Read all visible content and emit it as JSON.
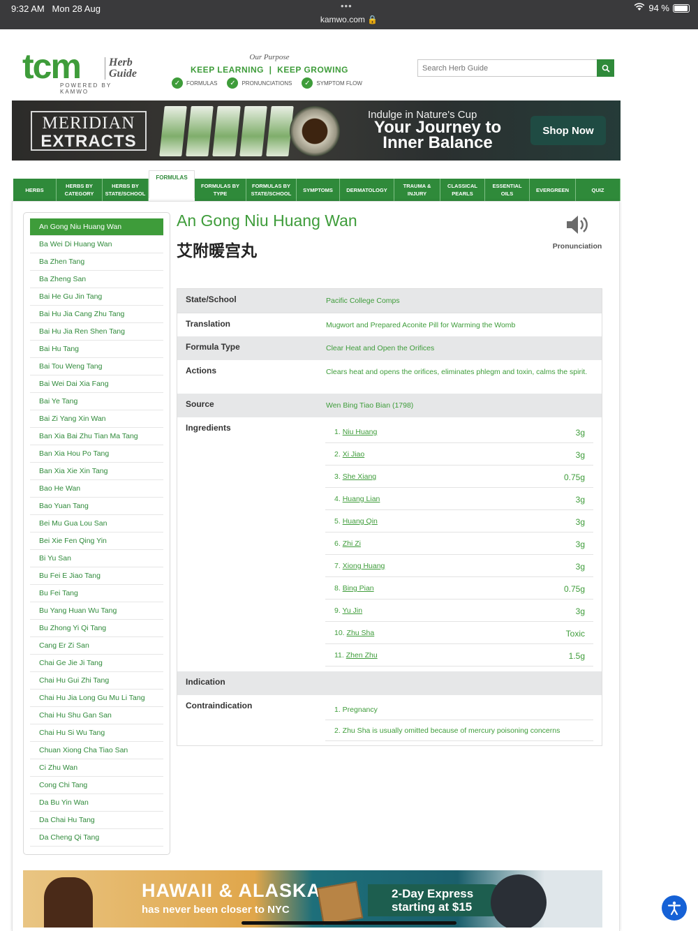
{
  "status_bar": {
    "time": "9:32 AM",
    "date": "Mon 28 Aug",
    "url": "kamwo.com",
    "battery": "94 %",
    "battery_level": 0.94
  },
  "header": {
    "logo_tcm": "tcm",
    "logo_herb": "Herb",
    "logo_guide": "Guide",
    "logo_powered": "POWERED BY KAMWO",
    "purpose_label": "Our Purpose",
    "purpose_text": "KEEP LEARNING  |  KEEP GROWING",
    "checks": [
      "FORMULAS",
      "PRONUNCIATIONS",
      "SYMPTOM FLOW"
    ],
    "search_placeholder": "Search Herb Guide"
  },
  "banner": {
    "brand_line1": "MERIDIAN",
    "brand_line2": "EXTRACTS",
    "tagline": "Indulge in Nature's Cup",
    "headline": "Your Journey to Inner Balance",
    "cta": "Shop Now"
  },
  "nav_tabs": [
    {
      "label": "HERBS"
    },
    {
      "label": "HERBS BY CATEGORY"
    },
    {
      "label": "HERBS BY STATE/SCHOOL"
    },
    {
      "label": "FORMULAS",
      "active": true
    },
    {
      "label": "FORMULAS BY TYPE"
    },
    {
      "label": "FORMULAS BY STATE/SCHOOL"
    },
    {
      "label": "SYMPTOMS"
    },
    {
      "label": "DERMATOLOGY"
    },
    {
      "label": "TRAUMA & INJURY"
    },
    {
      "label": "CLASSICAL PEARLS"
    },
    {
      "label": "ESSENTIAL OILS"
    },
    {
      "label": "EVERGREEN"
    },
    {
      "label": "QUIZ"
    }
  ],
  "formula_list": [
    "An Gong Niu Huang Wan",
    "Ba Wei Di Huang Wan",
    "Ba Zhen Tang",
    "Ba Zheng San",
    "Bai He Gu Jin Tang",
    "Bai Hu Jia Cang Zhu Tang",
    "Bai Hu Jia Ren Shen Tang",
    "Bai Hu Tang",
    "Bai Tou Weng Tang",
    "Bai Wei Dai Xia Fang",
    "Bai Ye Tang",
    "Bai Zi Yang Xin Wan",
    "Ban Xia Bai Zhu Tian Ma Tang",
    "Ban Xia Hou Po Tang",
    "Ban Xia Xie Xin Tang",
    "Bao He Wan",
    "Bao Yuan Tang",
    "Bei Mu Gua Lou San",
    "Bei Xie Fen Qing Yin",
    "Bi Yu San",
    "Bu Fei E Jiao Tang",
    "Bu Fei Tang",
    "Bu Yang Huan Wu Tang",
    "Bu Zhong Yi Qi Tang",
    "Cang Er Zi San",
    "Chai Ge Jie Ji Tang",
    "Chai Hu Gui Zhi Tang",
    "Chai Hu Jia Long Gu Mu Li Tang",
    "Chai Hu Shu Gan San",
    "Chai Hu Si Wu Tang",
    "Chuan Xiong Cha Tiao San",
    "Ci Zhu Wan",
    "Cong Chi Tang",
    "Da Bu Yin Wan",
    "Da Chai Hu Tang",
    "Da Cheng Qi Tang"
  ],
  "formula": {
    "name": "An Gong Niu Huang Wan",
    "chinese": "艾附暖宫丸",
    "pronunciation_label": "Pronunciation",
    "rows": {
      "state_school": {
        "label": "State/School",
        "value": "Pacific College Comps"
      },
      "translation": {
        "label": "Translation",
        "value": "Mugwort and Prepared Aconite Pill for Warming the Womb"
      },
      "formula_type": {
        "label": "Formula Type",
        "value": "Clear Heat and Open the Orifices"
      },
      "actions": {
        "label": "Actions",
        "value": "Clears heat and opens the orifices, eliminates phlegm and toxin, calms the spirit."
      },
      "source": {
        "label": "Source",
        "value": "Wen Bing Tiao Bian (1798)"
      },
      "ingredients": {
        "label": "Ingredients"
      },
      "indication": {
        "label": "Indication"
      },
      "contraindication": {
        "label": "Contraindication"
      }
    },
    "ingredients": [
      {
        "num": "1.",
        "name": "Niu Huang",
        "amount": "3g"
      },
      {
        "num": "2.",
        "name": "Xi Jiao",
        "amount": "3g"
      },
      {
        "num": "3.",
        "name": "She Xiang",
        "amount": "0.75g"
      },
      {
        "num": "4.",
        "name": "Huang Lian",
        "amount": "3g"
      },
      {
        "num": "5.",
        "name": "Huang Qin",
        "amount": "3g"
      },
      {
        "num": "6.",
        "name": "Zhi Zi",
        "amount": "3g"
      },
      {
        "num": "7.",
        "name": "Xiong Huang",
        "amount": "3g"
      },
      {
        "num": "8.",
        "name": "Bing Pian",
        "amount": "0.75g"
      },
      {
        "num": "9.",
        "name": "Yu Jin",
        "amount": "3g"
      },
      {
        "num": "10.",
        "name": "Zhu Sha",
        "amount": "Toxic"
      },
      {
        "num": "11.",
        "name": "Zhen Zhu",
        "amount": "1.5g"
      }
    ],
    "contraindications": [
      "1. Pregnancy",
      "2. Zhu Sha is usually omitted because of mercury poisoning concerns"
    ]
  },
  "ad": {
    "headline": "HAWAII & ALASKA",
    "subline": "has never been closer to NYC",
    "offer": "2-Day Express starting at $15"
  },
  "colors": {
    "brand_green": "#3e9c3a",
    "nav_green": "#2f8a3a",
    "row_grey": "#e6e7e8"
  }
}
